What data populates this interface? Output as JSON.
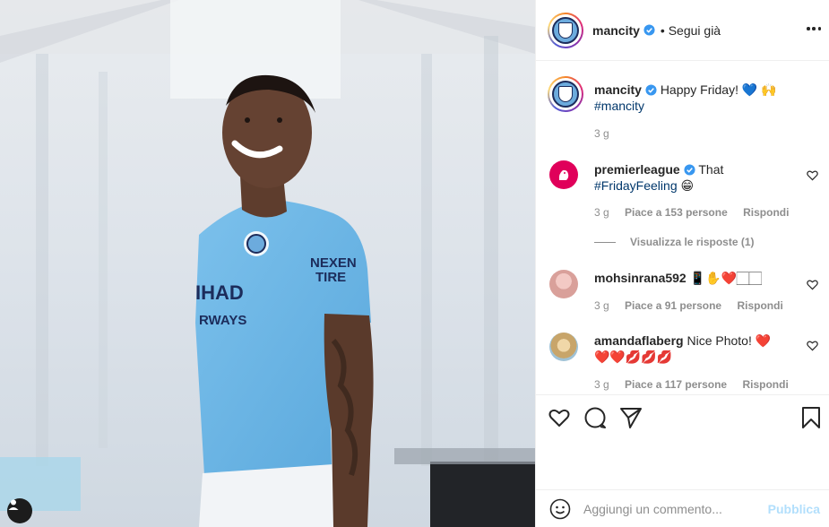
{
  "header": {
    "username": "mancity",
    "follow_label": "• Segui già"
  },
  "caption": {
    "username": "mancity",
    "text": "Happy Friday! 💙 🙌",
    "hashtag": "#mancity",
    "time": "3 g"
  },
  "comments": [
    {
      "username": "premierleague",
      "text": "That",
      "hashtag": "#FridayFeeling",
      "emoji": "😁",
      "time": "3 g",
      "likes": "Piace a 153 persone",
      "reply_label": "Rispondi",
      "view_replies": "Visualizza le risposte (1)"
    },
    {
      "username": "mohsinrana592",
      "text": "📱✋❤️🏻🏻",
      "time": "3 g",
      "likes": "Piace a 91 persone",
      "reply_label": "Rispondi"
    },
    {
      "username": "amandaflaberg",
      "text": "Nice Photo! ❤️",
      "text2": "❤️❤️💋💋💋",
      "time": "3 g",
      "likes": "Piace a 117 persone",
      "reply_label": "Rispondi"
    }
  ],
  "add_comment": {
    "placeholder": "Aggiungi un commento...",
    "publish_label": "Pubblica"
  },
  "icons": {
    "like": "heart-icon",
    "comment": "comment-icon",
    "share": "paper-plane-icon",
    "save": "bookmark-icon",
    "emoji": "smiley-icon",
    "more": "more-options-icon",
    "user_tag": "user-tag-icon"
  },
  "colors": {
    "verified": "#3897f0",
    "link": "#00376b",
    "meta": "#8e8e8e",
    "publish": "#b2dffc",
    "jersey": "#6cb4e4"
  }
}
